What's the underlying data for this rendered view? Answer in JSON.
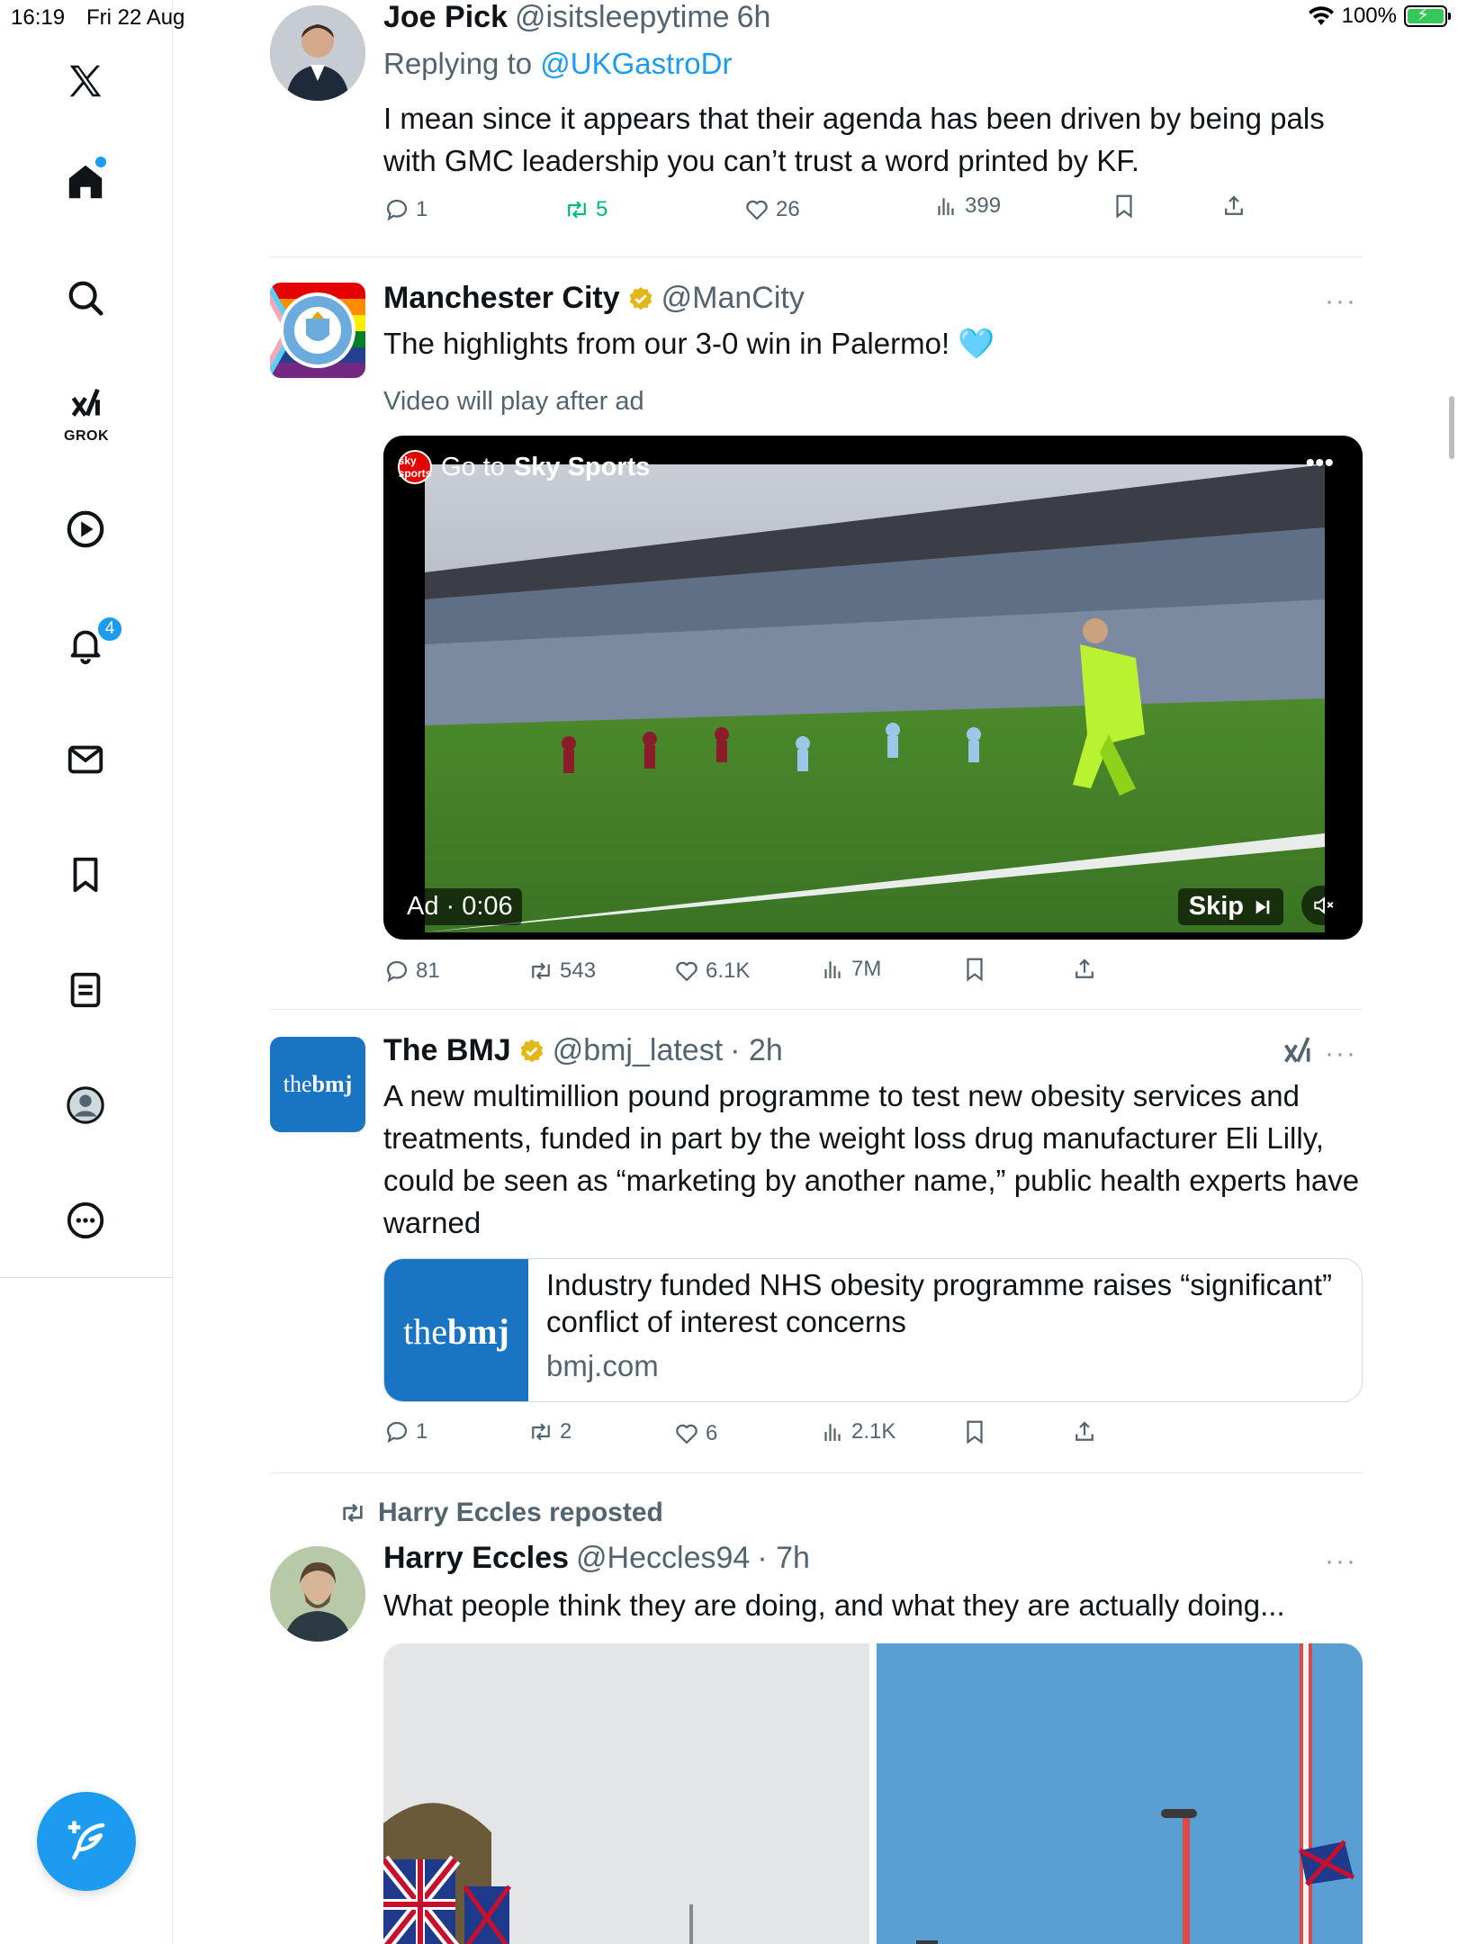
{
  "status_bar": {
    "time": "16:19",
    "date": "Fri 22 Aug",
    "battery": "100%"
  },
  "sidebar": {
    "brand": "X",
    "grok_label": "GROK",
    "notifications_badge": "4",
    "items": [
      "home",
      "explore",
      "grok",
      "videos",
      "notifications",
      "messages",
      "bookmarks",
      "lists",
      "profile",
      "more"
    ]
  },
  "colors": {
    "accent": "#1d9bf0",
    "repost_green": "#00ba7c",
    "secondary_text": "#536471"
  },
  "tweets": [
    {
      "name": "Joe Pick",
      "handle": "@isitsleepytime",
      "time": "6h",
      "replying_label": "Replying to",
      "replying_to": "@UKGastroDr",
      "text": "I mean since it appears that their agenda has been driven by being pals with GMC leadership you can’t trust a word printed by KF.",
      "replies": "1",
      "reposts": "5",
      "likes": "26",
      "views": "399"
    },
    {
      "name": "Manchester City",
      "handle": "@ManCity",
      "text": "The highlights from our 3-0 win in Palermo! 🩵",
      "video_note": "Video will play after ad",
      "video": {
        "cta_prefix": "Go to",
        "cta_brand": "Sky Sports",
        "sky_badge": "sky sports",
        "ad_label": "Ad · 0:06",
        "skip_label": "Skip"
      },
      "replies": "81",
      "reposts": "543",
      "likes": "6.1K",
      "views": "7M"
    },
    {
      "name": "The BMJ",
      "handle": "@bmj_latest",
      "time": "· 2h",
      "text": "A new multimillion pound programme to test new obesity services and treatments, funded in part by the weight loss drug manufacturer Eli Lilly, could be seen as “marketing by another name,” public health experts have warned",
      "card": {
        "logo_prefix": "the",
        "logo_bold": "bmj",
        "title": "Industry funded NHS obesity programme raises “significant” conflict of interest concerns",
        "domain": "bmj.com"
      },
      "replies": "1",
      "reposts": "2",
      "likes": "6",
      "views": "2.1K"
    },
    {
      "repost_label": "Harry Eccles reposted",
      "name": "Harry Eccles",
      "handle": "@Heccles94",
      "time": "· 7h",
      "text": "What people think they are doing, and what they are actually doing..."
    }
  ]
}
